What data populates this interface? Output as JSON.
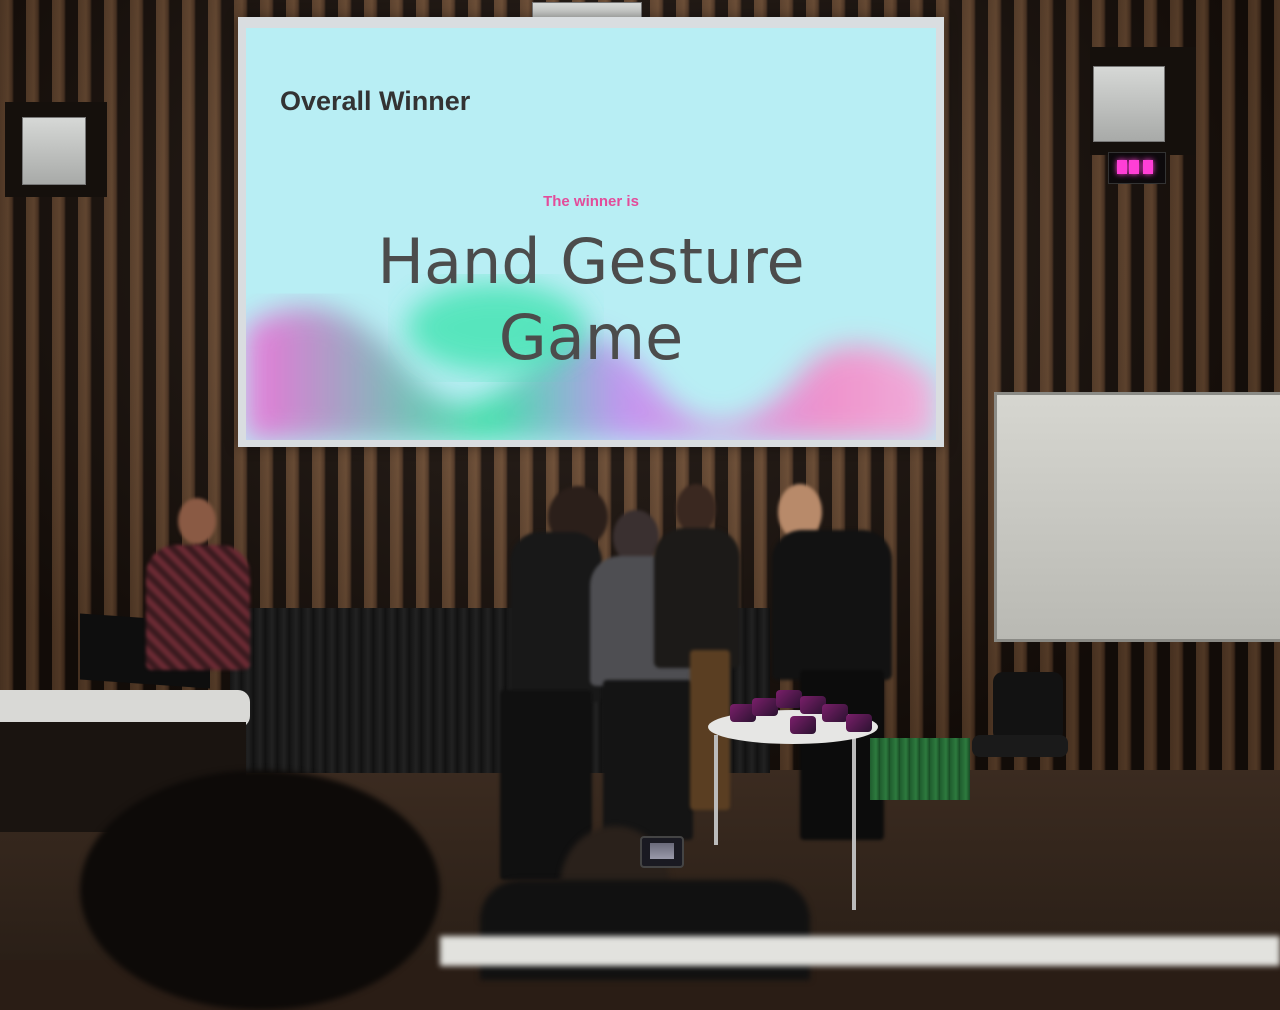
{
  "slide": {
    "title": "Overall Winner",
    "kicker": "The winner is",
    "headline_line1": "Hand Gesture",
    "headline_line2": "Game",
    "colors": {
      "background": "#b8eef4",
      "kicker": "#e34c9a",
      "wave_pink": "#f06ad6",
      "wave_green": "#33e0a0"
    }
  }
}
